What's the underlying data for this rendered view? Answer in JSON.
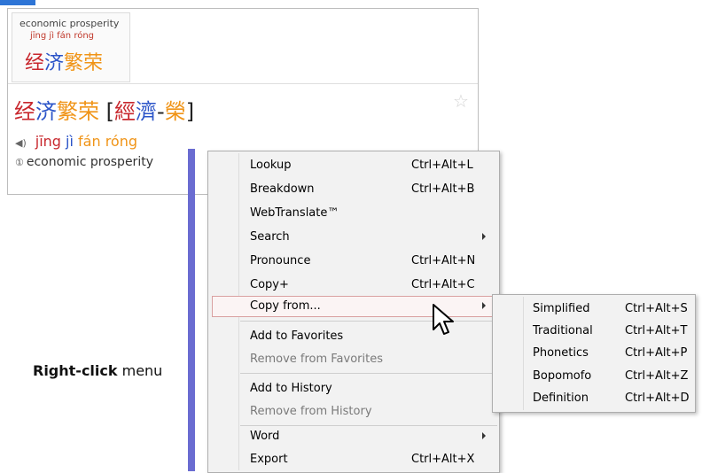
{
  "dict": {
    "card": {
      "gloss": "economic prosperity",
      "pinyin": "jīng jì fán róng",
      "hanzi": [
        "经",
        "济",
        "繁",
        "荣"
      ]
    },
    "headword": {
      "simplified": [
        "经",
        "济",
        "繁",
        "荣"
      ],
      "traditional_open": "[",
      "traditional": [
        "經",
        "濟",
        "-",
        "榮"
      ],
      "traditional_close": "]"
    },
    "pinyin": [
      "jīng",
      "jì",
      "fán",
      "róng"
    ],
    "definition_number": "①",
    "definition": "economic prosperity",
    "tone_colors": {
      "tone1": "#c8272d",
      "tone2": "#f09417",
      "tone4": "#2b54c8"
    }
  },
  "caption": {
    "bold": "Right-click",
    "rest": " menu"
  },
  "menu": {
    "items": [
      {
        "label": "Lookup",
        "shortcut": "Ctrl+Alt+L"
      },
      {
        "label": "Breakdown",
        "shortcut": "Ctrl+Alt+B"
      },
      {
        "label": "WebTranslate™",
        "shortcut": ""
      },
      {
        "label": "Search",
        "shortcut": ""
      },
      {
        "label": "Pronounce",
        "shortcut": "Ctrl+Alt+N"
      },
      {
        "label": "Copy+",
        "shortcut": "Ctrl+Alt+C"
      },
      {
        "label": "Copy from...",
        "shortcut": ""
      },
      {
        "label": "Add to Favorites",
        "shortcut": ""
      },
      {
        "label": "Remove from Favorites",
        "shortcut": ""
      },
      {
        "label": "Add to History",
        "shortcut": ""
      },
      {
        "label": "Remove from History",
        "shortcut": ""
      },
      {
        "label": "Word",
        "shortcut": ""
      },
      {
        "label": "Export",
        "shortcut": "Ctrl+Alt+X"
      }
    ]
  },
  "submenu": {
    "items": [
      {
        "label": "Simplified",
        "shortcut": "Ctrl+Alt+S"
      },
      {
        "label": "Traditional",
        "shortcut": "Ctrl+Alt+T"
      },
      {
        "label": "Phonetics",
        "shortcut": "Ctrl+Alt+P"
      },
      {
        "label": "Bopomofo",
        "shortcut": "Ctrl+Alt+Z"
      },
      {
        "label": "Definition",
        "shortcut": "Ctrl+Alt+D"
      }
    ]
  }
}
